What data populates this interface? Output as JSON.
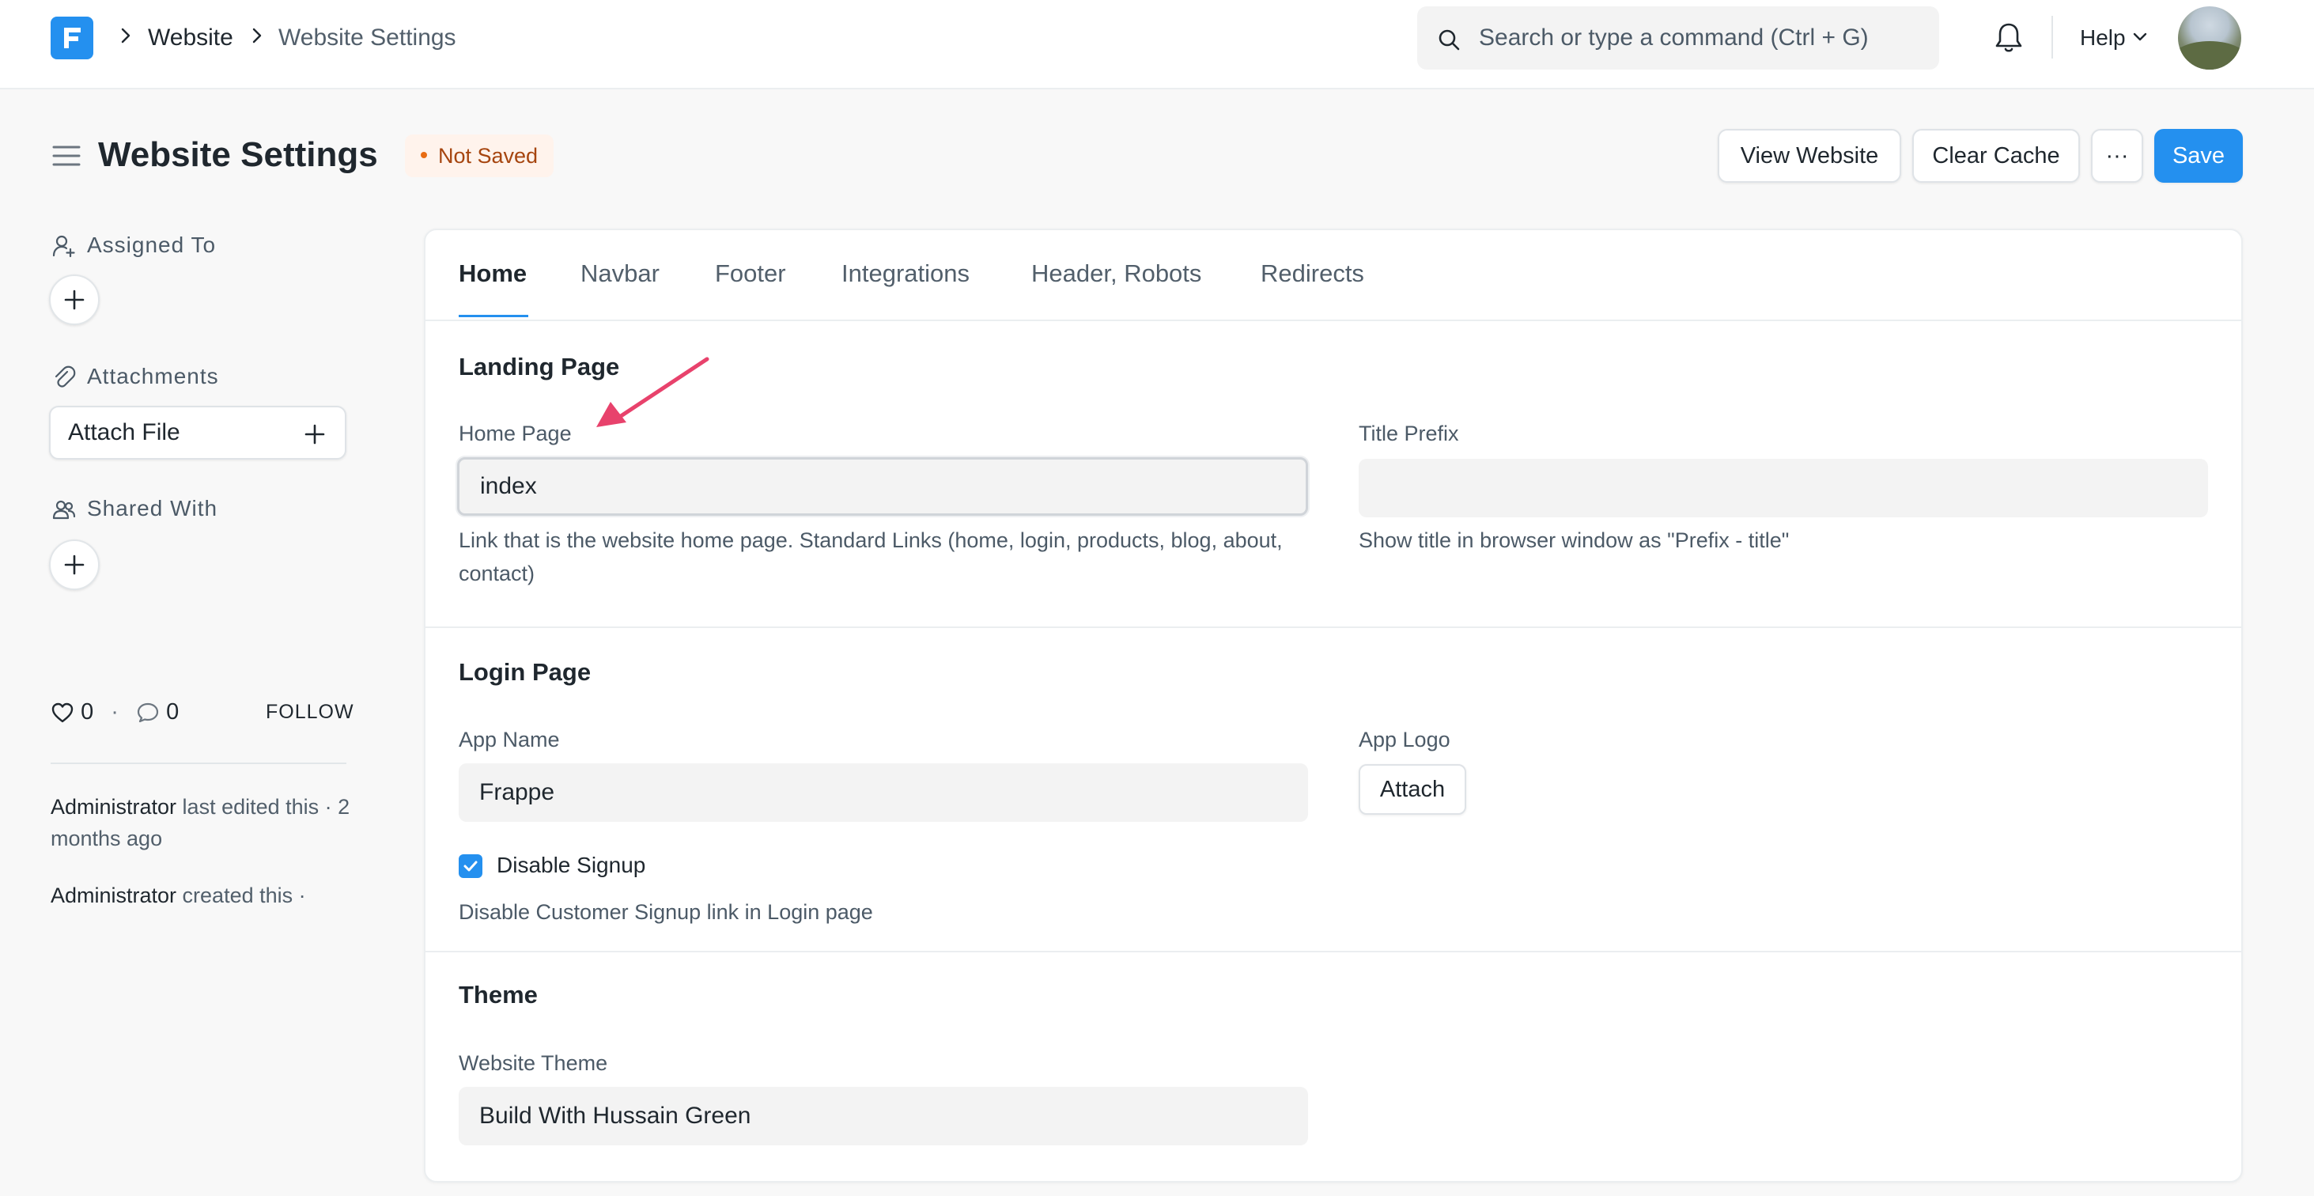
{
  "navbar": {
    "breadcrumbs": [
      "Website",
      "Website Settings"
    ],
    "search_placeholder": "Search or type a command (Ctrl + G)",
    "help_label": "Help"
  },
  "page": {
    "title": "Website Settings",
    "status": "Not Saved",
    "actions": {
      "view_website": "View Website",
      "clear_cache": "Clear Cache",
      "more": "···",
      "save": "Save"
    }
  },
  "sidebar": {
    "assigned_to": "Assigned To",
    "attachments": "Attachments",
    "attach_file": "Attach File",
    "shared_with": "Shared With",
    "likes_count": "0",
    "comments_count": "0",
    "follow": "FOLLOW",
    "activity": [
      {
        "user": "Administrator",
        "text": " last edited this · 2 months ago"
      },
      {
        "user": "Administrator",
        "text": " created this ·"
      }
    ]
  },
  "tabs": [
    "Home",
    "Navbar",
    "Footer",
    "Integrations",
    "Header, Robots",
    "Redirects"
  ],
  "active_tab": "Home",
  "sections": {
    "landing": {
      "title": "Landing Page",
      "home_page_label": "Home Page",
      "home_page_value": "index",
      "home_page_desc": "Link that is the website home page. Standard Links (home, login, products, blog, about, contact)",
      "title_prefix_label": "Title Prefix",
      "title_prefix_value": "",
      "title_prefix_desc": "Show title in browser window as \"Prefix - title\""
    },
    "login": {
      "title": "Login Page",
      "app_name_label": "App Name",
      "app_name_value": "Frappe",
      "app_logo_label": "App Logo",
      "attach_label": "Attach",
      "disable_signup_label": "Disable Signup",
      "disable_signup_checked": true,
      "disable_signup_desc": "Disable Customer Signup link in Login page"
    },
    "theme": {
      "title": "Theme",
      "website_theme_label": "Website Theme",
      "website_theme_value": "Build With Hussain Green"
    }
  },
  "colors": {
    "primary": "#2490ef",
    "annotation_arrow": "#e8426c",
    "not_saved_text": "#a6450f",
    "not_saved_bg": "#fff3ec"
  }
}
